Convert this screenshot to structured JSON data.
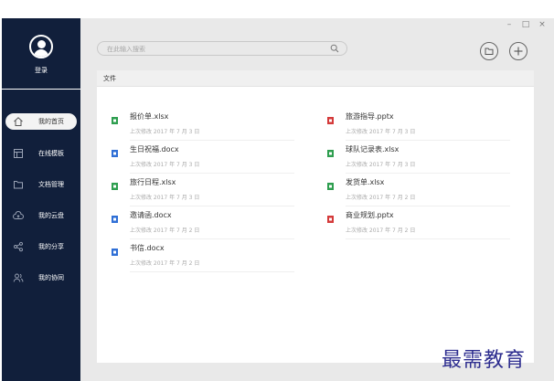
{
  "sidebar": {
    "login_label": "登录",
    "items": [
      {
        "label": "我的首页",
        "icon": "home-icon",
        "active": true
      },
      {
        "label": "在线模板",
        "icon": "template-icon",
        "active": false
      },
      {
        "label": "文档管理",
        "icon": "folder-icon",
        "active": false
      },
      {
        "label": "我的云盘",
        "icon": "cloud-icon",
        "active": false
      },
      {
        "label": "我的分享",
        "icon": "share-icon",
        "active": false
      },
      {
        "label": "我的协同",
        "icon": "collaborate-icon",
        "active": false
      }
    ]
  },
  "window": {
    "minimize": "–",
    "maximize": "□",
    "close": "×"
  },
  "search": {
    "placeholder": "在此输入搜索"
  },
  "files_section": {
    "title": "文件",
    "files": [
      {
        "name": "报价单.xlsx",
        "meta": "上次修改 2017 年 7 月 3 日",
        "type": "xlsx",
        "color": "#2e9e4f"
      },
      {
        "name": "旅游指导.pptx",
        "meta": "上次修改 2017 年 7 月 3 日",
        "type": "pptx",
        "color": "#d43a3a"
      },
      {
        "name": "生日祝福.docx",
        "meta": "上次修改 2017 年 7 月 3 日",
        "type": "docx",
        "color": "#2f6fd6"
      },
      {
        "name": "球队记录表.xlsx",
        "meta": "上次修改 2017 年 7 月 3 日",
        "type": "xlsx",
        "color": "#2e9e4f"
      },
      {
        "name": "旅行日程.xlsx",
        "meta": "上次修改 2017 年 7 月 3 日",
        "type": "xlsx",
        "color": "#2e9e4f"
      },
      {
        "name": "发货单.xlsx",
        "meta": "上次修改 2017 年 7 月 2 日",
        "type": "xlsx",
        "color": "#2e9e4f"
      },
      {
        "name": "邀请函.docx",
        "meta": "上次修改 2017 年 7 月 2 日",
        "type": "docx",
        "color": "#2f6fd6"
      },
      {
        "name": "商业规划.pptx",
        "meta": "上次修改 2017 年 7 月 2 日",
        "type": "pptx",
        "color": "#d43a3a"
      },
      {
        "name": "书信.docx",
        "meta": "上次修改 2017 年 7 月 2 日",
        "type": "docx",
        "color": "#2f6fd6"
      }
    ]
  },
  "watermark": "最需教育"
}
